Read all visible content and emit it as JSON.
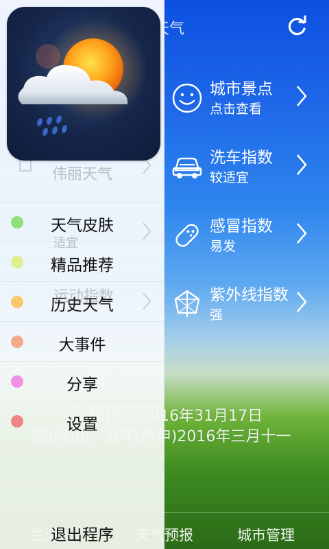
{
  "main": {
    "header_title": "天气",
    "indices": [
      {
        "title": "城市景点",
        "value": "点击查看",
        "icon": "smiley-icon"
      },
      {
        "title": "洗车指数",
        "value": "较适宜",
        "icon": "car-icon"
      },
      {
        "title": "感冒指数",
        "value": "易发",
        "icon": "pill-icon"
      },
      {
        "title": "紫外线指数",
        "value": "强",
        "icon": "umbrella-icon"
      }
    ],
    "gregorian_date": "公(阳)历：2016年31月17日",
    "lunar_date": "农(阴)历：猴年(丙申)2016年三月十一",
    "tabs": [
      {
        "label": "生活"
      },
      {
        "label": "天气预报"
      },
      {
        "label": "城市管理"
      }
    ]
  },
  "drawer": {
    "ghost_texts": {
      "title1": "伟丽天气",
      "wash": "适宜",
      "sport": "运动指数"
    },
    "menu": [
      {
        "label": "天气皮肤",
        "dot_color": "#8de07a"
      },
      {
        "label": "精品推荐",
        "dot_color": "#dff08a"
      },
      {
        "label": "历史天气",
        "dot_color": "#f7c96a"
      },
      {
        "label": "大事件",
        "dot_color": "#f3a98a"
      },
      {
        "label": "分享",
        "dot_color": "#f08fe6"
      },
      {
        "label": "设置",
        "dot_color": "#f08484"
      }
    ],
    "exit_label": "退出程序"
  },
  "colors": {
    "sky_top": "#0c4fe0",
    "grass": "#3c8a20"
  }
}
